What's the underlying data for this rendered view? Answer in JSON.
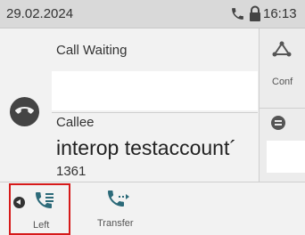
{
  "status": {
    "date": "29.02.2024",
    "time": "16:13"
  },
  "call_waiting": {
    "label": "Call Waiting"
  },
  "callee": {
    "label": "Callee",
    "name": "interop testaccount´",
    "number": "1361"
  },
  "sidebar": {
    "conf_label": "Conf"
  },
  "softkeys": {
    "left_label": "Left",
    "transfer_label": "Transfer"
  },
  "icons": {
    "phone": "phone-icon",
    "lock": "lock-icon",
    "hangup": "hangup-icon",
    "conference": "conference-icon",
    "left": "left-arrow-icon",
    "transfer": "transfer-icon"
  },
  "colors": {
    "highlight": "#d61a1a",
    "status_bar": "#d9d9d9"
  }
}
